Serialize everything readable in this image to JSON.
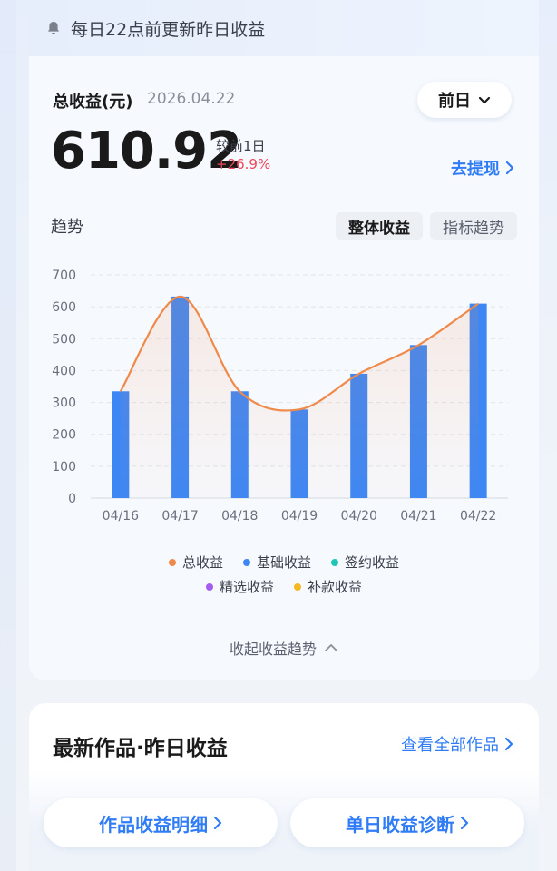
{
  "notice": {
    "text": "每日22点前更新昨日收益"
  },
  "summary": {
    "label": "总收益(元)",
    "date": "2026.04.22",
    "range": "前日",
    "amount": "610.92",
    "compare_label": "较前1日",
    "compare_value": "+26.9%",
    "withdraw_label": "去提现"
  },
  "trend": {
    "title": "趋势",
    "tabs": [
      "整体收益",
      "指标趋势"
    ],
    "active_tab": "整体收益",
    "collapse_label": "收起收益趋势"
  },
  "chart_data": {
    "type": "bar",
    "categories": [
      "04/16",
      "04/17",
      "04/18",
      "04/19",
      "04/20",
      "04/21",
      "04/22"
    ],
    "series": [
      {
        "name": "基础收益",
        "type": "bar",
        "color": "#3d87f5",
        "values": [
          335,
          632,
          335,
          278,
          390,
          480,
          610
        ]
      },
      {
        "name": "总收益",
        "type": "line",
        "color": "#f08a4b",
        "values": [
          335,
          632,
          335,
          278,
          390,
          480,
          610
        ]
      }
    ],
    "legend": [
      {
        "name": "总收益",
        "color": "#f08a4b"
      },
      {
        "name": "基础收益",
        "color": "#3d87f5"
      },
      {
        "name": "签约收益",
        "color": "#1fc6b6"
      },
      {
        "name": "精选收益",
        "color": "#a55cf0"
      },
      {
        "name": "补款收益",
        "color": "#f5b820"
      }
    ],
    "yticks": [
      0,
      100,
      200,
      300,
      400,
      500,
      600,
      700
    ],
    "ylim": [
      0,
      700
    ],
    "grid": true,
    "legend_position": "bottom"
  },
  "latest": {
    "title": "最新作品·昨日收益",
    "view_all": "查看全部作品"
  },
  "bottom_buttons": {
    "detail": "作品收益明细",
    "diagnose": "单日收益诊断"
  }
}
